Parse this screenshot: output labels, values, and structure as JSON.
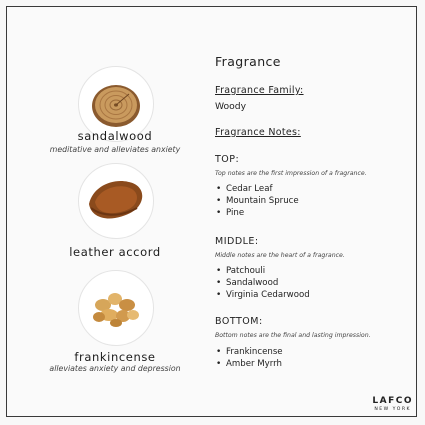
{
  "ingredients": [
    {
      "name": "sandalwood",
      "desc": "meditative and alleviates anxiety",
      "icon": "wood-slice-icon"
    },
    {
      "name": "leather accord",
      "desc": "",
      "icon": "leather-icon"
    },
    {
      "name": "frankincense",
      "desc": "alleviates anxiety and depression",
      "icon": "resin-icon"
    }
  ],
  "fragrance": {
    "title": "Fragrance",
    "family_label": "Fragrance Family:",
    "family_value": "Woody",
    "notes_label": "Fragrance Notes:",
    "top": {
      "label": "TOP:",
      "desc": "Top notes are the first impression of a fragrance.",
      "items": [
        "Cedar Leaf",
        "Mountain Spruce",
        "Pine"
      ]
    },
    "middle": {
      "label": "MIDDLE:",
      "desc": "Middle notes are the heart of a fragrance.",
      "items": [
        "Patchouli",
        "Sandalwood",
        "Virginia Cedarwood"
      ]
    },
    "bottom": {
      "label": "BOTTOM:",
      "desc": "Bottom notes are the final and lasting impression.",
      "items": [
        "Frankincense",
        "Amber Myrrh"
      ]
    }
  },
  "brand": {
    "name": "LAFCO",
    "city": "NEW YORK"
  }
}
